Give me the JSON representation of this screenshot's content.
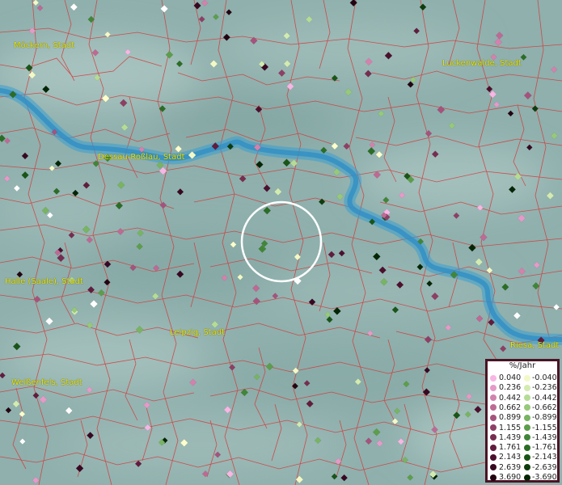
{
  "cities": [
    {
      "name": "Möckern, Stadt"
    },
    {
      "name": "Luckenwalde, Stadt"
    },
    {
      "name": "Dessau-Roßlau, Stadt"
    },
    {
      "name": "Halle (Saale), Stadt"
    },
    {
      "name": "Leipzig, Stadt"
    },
    {
      "name": "Weißenfels, Stadt"
    },
    {
      "name": "Riesa, Stadt"
    }
  ],
  "legend": {
    "title": "%/Jahr",
    "positive": [
      {
        "label": "0.040",
        "color": "#f7b6e4"
      },
      {
        "label": "0.236",
        "color": "#e59ac8"
      },
      {
        "label": "0.442",
        "color": "#d282ad"
      },
      {
        "label": "0.662",
        "color": "#bd6a95"
      },
      {
        "label": "0.899",
        "color": "#a5537d"
      },
      {
        "label": "1.155",
        "color": "#8e3f66"
      },
      {
        "label": "1.439",
        "color": "#772c51"
      },
      {
        "label": "1.761",
        "color": "#611c3e"
      },
      {
        "label": "2.143",
        "color": "#4c102f"
      },
      {
        "label": "2.639",
        "color": "#380822"
      },
      {
        "label": "3.690",
        "color": "#230412"
      }
    ],
    "negative": [
      {
        "label": "-0.040",
        "color": "#f3f9c6"
      },
      {
        "label": "-0.236",
        "color": "#d3ebb0"
      },
      {
        "label": "-0.442",
        "color": "#b5dc95"
      },
      {
        "label": "-0.662",
        "color": "#96c97a"
      },
      {
        "label": "-0.899",
        "color": "#78b462"
      },
      {
        "label": "-1.155",
        "color": "#5c9e4b"
      },
      {
        "label": "-1.439",
        "color": "#418638"
      },
      {
        "label": "-1.761",
        "color": "#2c6d26"
      },
      {
        "label": "-2.143",
        "color": "#1a5518"
      },
      {
        "label": "-2.639",
        "color": "#0d3d0c"
      },
      {
        "label": "-3.690",
        "color": "#042604"
      }
    ]
  },
  "colors": {
    "background": "#8fb0ad",
    "river": "#3c9cc8",
    "boundary": "#d23a3a",
    "label": "#e6e600",
    "selection_ring": "#ffffff"
  }
}
